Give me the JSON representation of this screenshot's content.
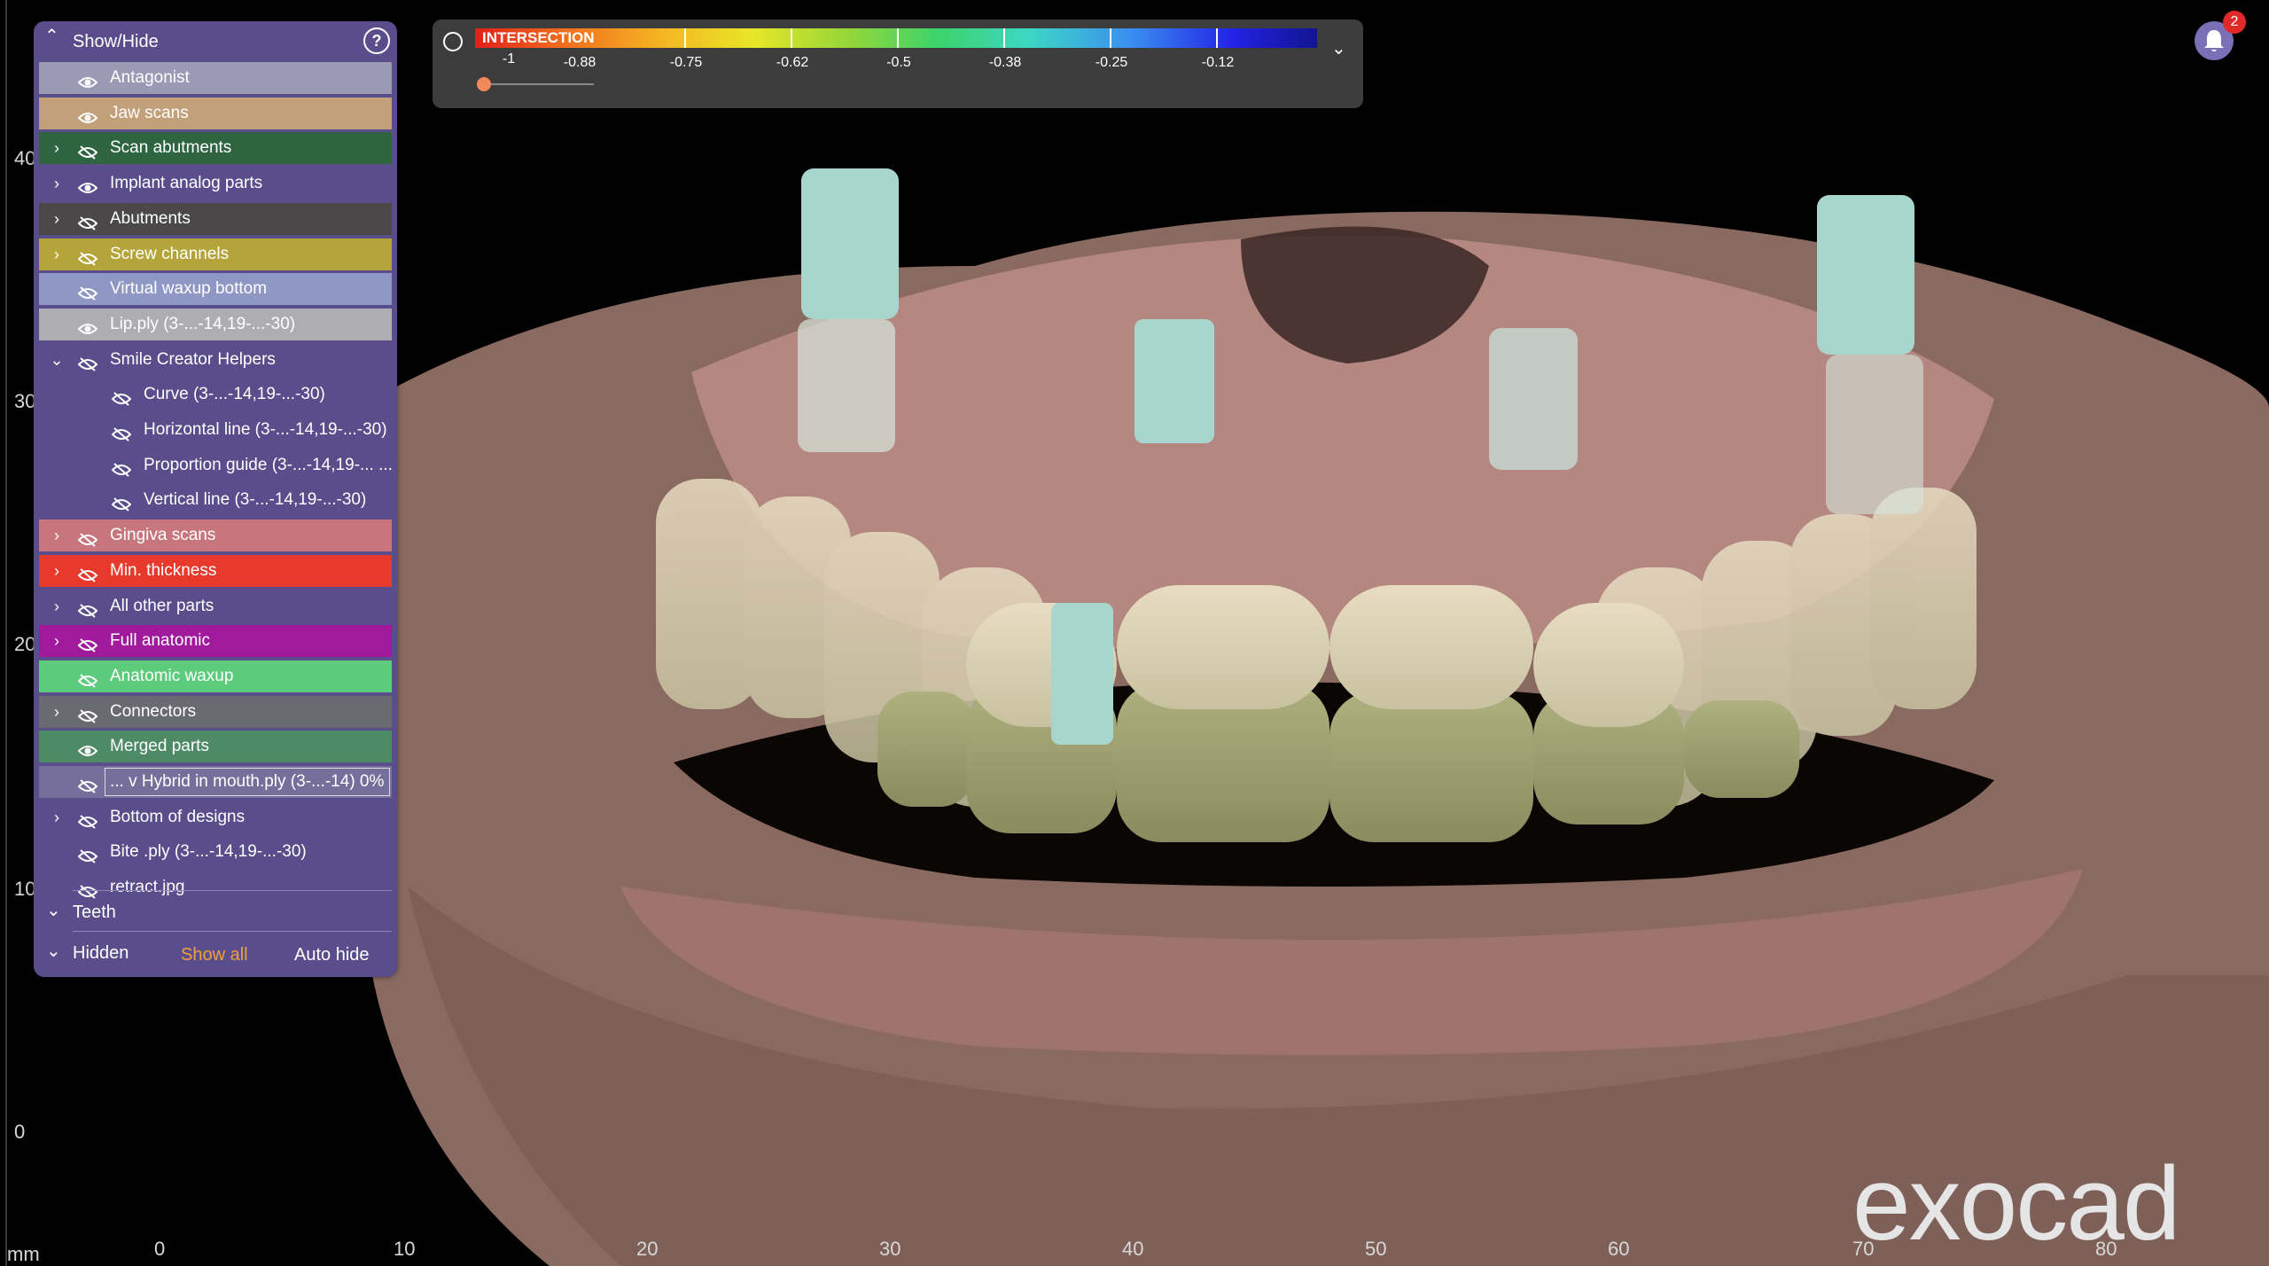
{
  "panel": {
    "title": "Show/Hide",
    "help_icon": "question-circle-icon",
    "items": [
      {
        "label": "Antagonist",
        "chevron": "",
        "eye": "visible",
        "color": "#9a9ab4"
      },
      {
        "label": "Jaw scans",
        "chevron": "",
        "eye": "visible",
        "color": "#c2a07a"
      },
      {
        "label": "Scan abutments",
        "chevron": "›",
        "eye": "hidden",
        "color": "#2e6440"
      },
      {
        "label": "Implant analog parts",
        "chevron": "›",
        "eye": "visible",
        "color": ""
      },
      {
        "label": "Abutments",
        "chevron": "›",
        "eye": "hidden",
        "color": "#4a4848"
      },
      {
        "label": "Screw channels",
        "chevron": "›",
        "eye": "hidden",
        "color": "#b4a43a"
      },
      {
        "label": "Virtual waxup bottom",
        "chevron": "",
        "eye": "hidden",
        "color": "#8f98c4"
      },
      {
        "label": "Lip.ply (3-...-14,19-...-30)",
        "chevron": "",
        "eye": "visible",
        "color": "#aeaeb2"
      },
      {
        "label": "Smile Creator Helpers",
        "chevron": "⌄",
        "eye": "hidden",
        "color": ""
      },
      {
        "label": "Curve (3-...-14,19-...-30)",
        "chevron": "",
        "eye": "hidden",
        "color": "",
        "sub": true
      },
      {
        "label": "Horizontal line (3-...-14,19-...-30)",
        "chevron": "",
        "eye": "hidden",
        "color": "",
        "sub": true
      },
      {
        "label": "Proportion guide (3-...-14,19-... ...",
        "chevron": "",
        "eye": "hidden",
        "color": "",
        "sub": true
      },
      {
        "label": "Vertical line (3-...-14,19-...-30)",
        "chevron": "",
        "eye": "hidden",
        "color": "",
        "sub": true
      },
      {
        "label": "Gingiva scans",
        "chevron": "›",
        "eye": "hidden",
        "color": "#c8767e"
      },
      {
        "label": "Min. thickness",
        "chevron": "›",
        "eye": "hidden",
        "color": "#e83a2c"
      },
      {
        "label": "All other parts",
        "chevron": "›",
        "eye": "hidden",
        "color": ""
      },
      {
        "label": "Full anatomic",
        "chevron": "›",
        "eye": "hidden",
        "color": "#a11a9e"
      },
      {
        "label": "Anatomic waxup",
        "chevron": "",
        "eye": "hidden",
        "color": "#5ccc7c"
      },
      {
        "label": "Connectors",
        "chevron": "›",
        "eye": "hidden",
        "color": "#6a6a72"
      },
      {
        "label": "Merged parts",
        "chevron": "",
        "eye": "visible",
        "color": "#4e8a66"
      },
      {
        "label": "... v Hybrid in mouth.ply (3-...-14)  0%",
        "chevron": "",
        "eye": "hidden",
        "color": "#766f9c",
        "slider": true
      },
      {
        "label": "Bottom of designs",
        "chevron": "›",
        "eye": "hidden",
        "color": ""
      },
      {
        "label": "Bite .ply (3-...-14,19-...-30)",
        "chevron": "",
        "eye": "hidden",
        "color": ""
      },
      {
        "label": "retract.jpg",
        "chevron": "",
        "eye": "hidden",
        "color": ""
      }
    ],
    "teeth_label": "Teeth",
    "hidden_label": "Hidden",
    "show_all_label": "Show all",
    "auto_hide_label": "Auto hide",
    "accent": "#f0a03c"
  },
  "colormap": {
    "title": "INTERSECTION",
    "ticks": [
      "-1",
      "-0.88",
      "-0.75",
      "-0.62",
      "-0.5",
      "-0.38",
      "-0.25",
      "-0.12"
    ],
    "dropdown_icon": "chevron-down-icon",
    "gauge_icon": "gauge-icon",
    "slider_value": 0
  },
  "notifications": {
    "count": "2",
    "icon": "bell-icon"
  },
  "ruler": {
    "unit": "mm",
    "x_ticks": [
      "0",
      "10",
      "20",
      "30",
      "40",
      "50",
      "60",
      "70",
      "80"
    ],
    "y_ticks": [
      "40",
      "30",
      "20",
      "10",
      "0"
    ]
  },
  "logo": "exocad"
}
